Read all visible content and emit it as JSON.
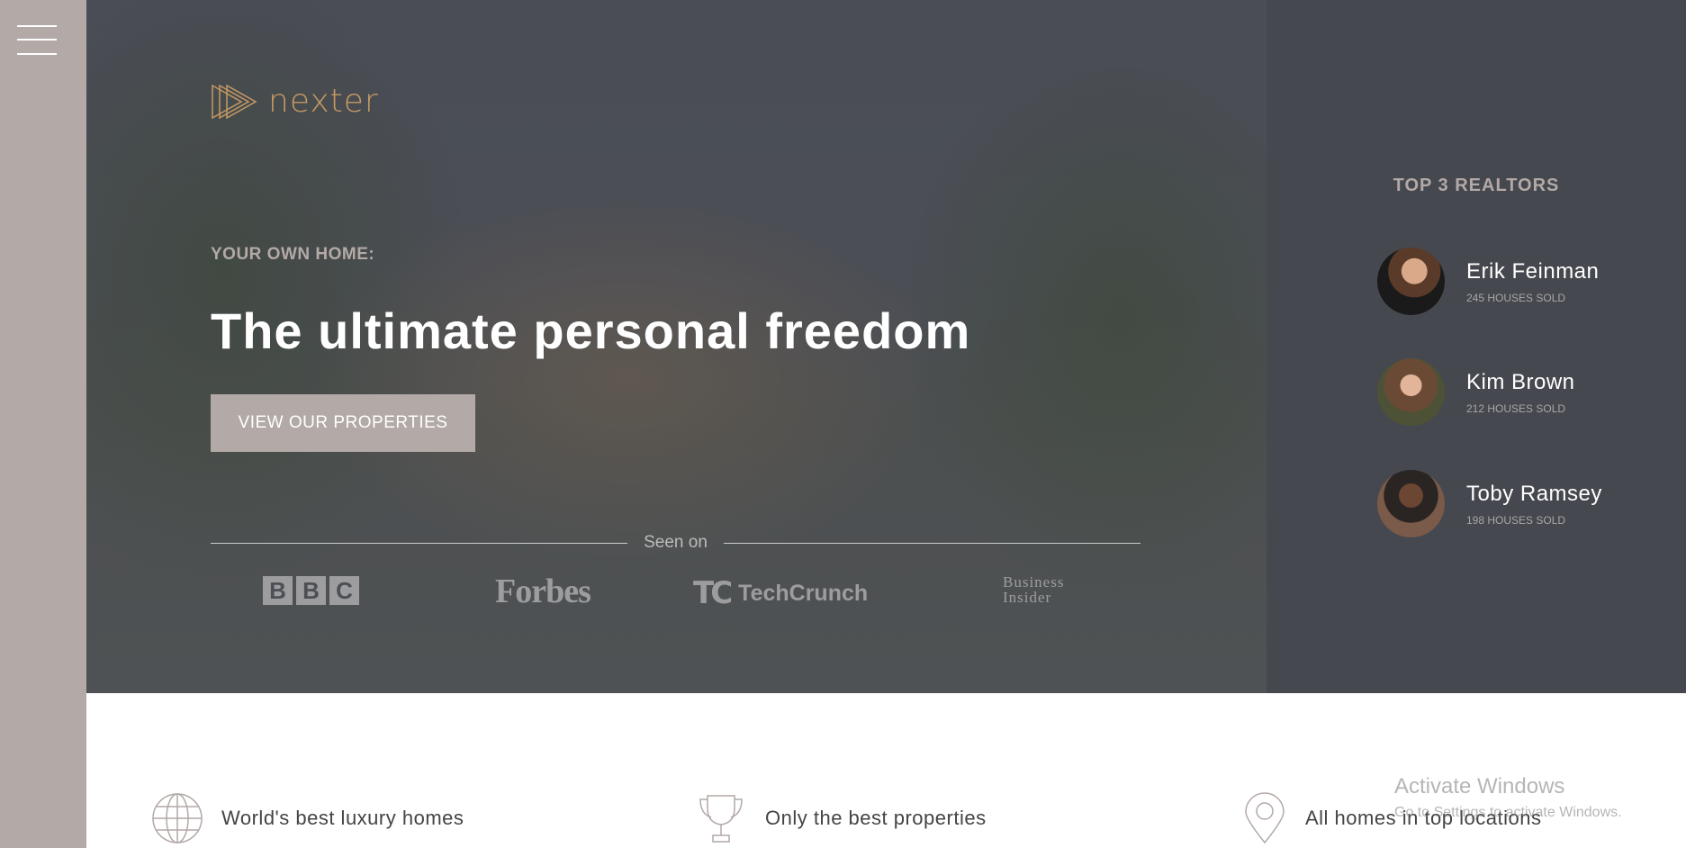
{
  "sidebar": {
    "menu_icon": "hamburger-icon"
  },
  "hero": {
    "logo_text": "nexter",
    "subhead": "YOUR OWN HOME:",
    "headline": "The ultimate personal freedom",
    "cta_label": "VIEW OUR PROPERTIES",
    "seen_on": "Seen on",
    "brands": {
      "bbc": [
        "B",
        "B",
        "C"
      ],
      "forbes": "Forbes",
      "techcrunch_mark": "TC",
      "techcrunch": "TechCrunch",
      "business_insider": [
        "Business",
        "Insider"
      ]
    }
  },
  "realtors": {
    "title": "TOP 3 REALTORS",
    "items": [
      {
        "name": "Erik Feinman",
        "sold": "245 HOUSES SOLD"
      },
      {
        "name": "Kim Brown",
        "sold": "212 HOUSES SOLD"
      },
      {
        "name": "Toby Ramsey",
        "sold": "198 HOUSES SOLD"
      }
    ]
  },
  "features": [
    {
      "icon": "globe-icon",
      "label": "World's best luxury homes"
    },
    {
      "icon": "trophy-icon",
      "label": "Only the best properties"
    },
    {
      "icon": "map-pin-icon",
      "label": "All homes in top locations"
    }
  ],
  "windows_watermark": {
    "title": "Activate Windows",
    "subtitle": "Go to Settings to activate Windows."
  },
  "colors": {
    "primary": "#c69963",
    "grey": "#b3a9a7",
    "dark": "#45484e"
  }
}
